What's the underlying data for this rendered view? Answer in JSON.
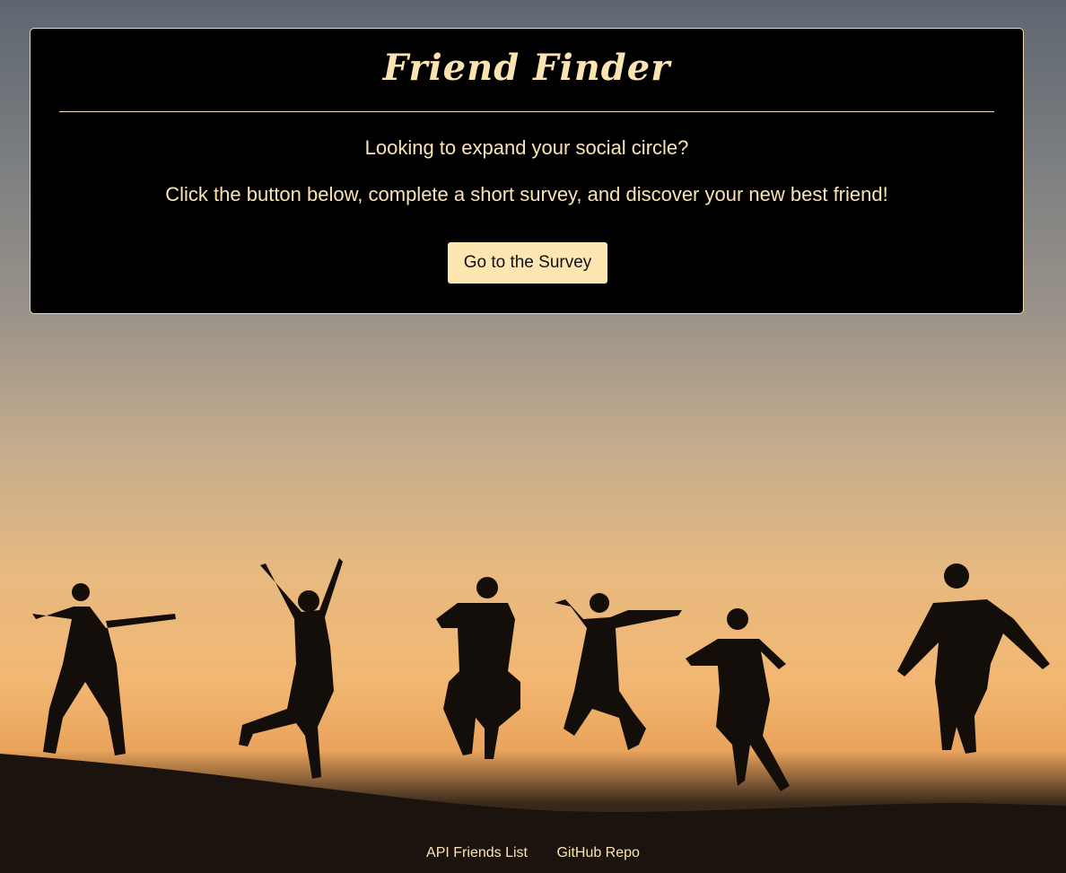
{
  "header": {
    "title": "Friend Finder",
    "tagline": "Looking to expand your social circle?",
    "instructions": "Click the button below, complete a short survey, and discover your new best friend!",
    "button_label": "Go to the Survey"
  },
  "footer": {
    "links": [
      {
        "label": "API Friends List"
      },
      {
        "label": "GitHub Repo"
      }
    ]
  },
  "colors": {
    "panel_bg": "#000000",
    "accent_text": "#fbe3b2",
    "button_bg": "#fde6b2"
  },
  "background": {
    "image_subject": "silhouettes-of-people-jumping-at-sunset"
  }
}
